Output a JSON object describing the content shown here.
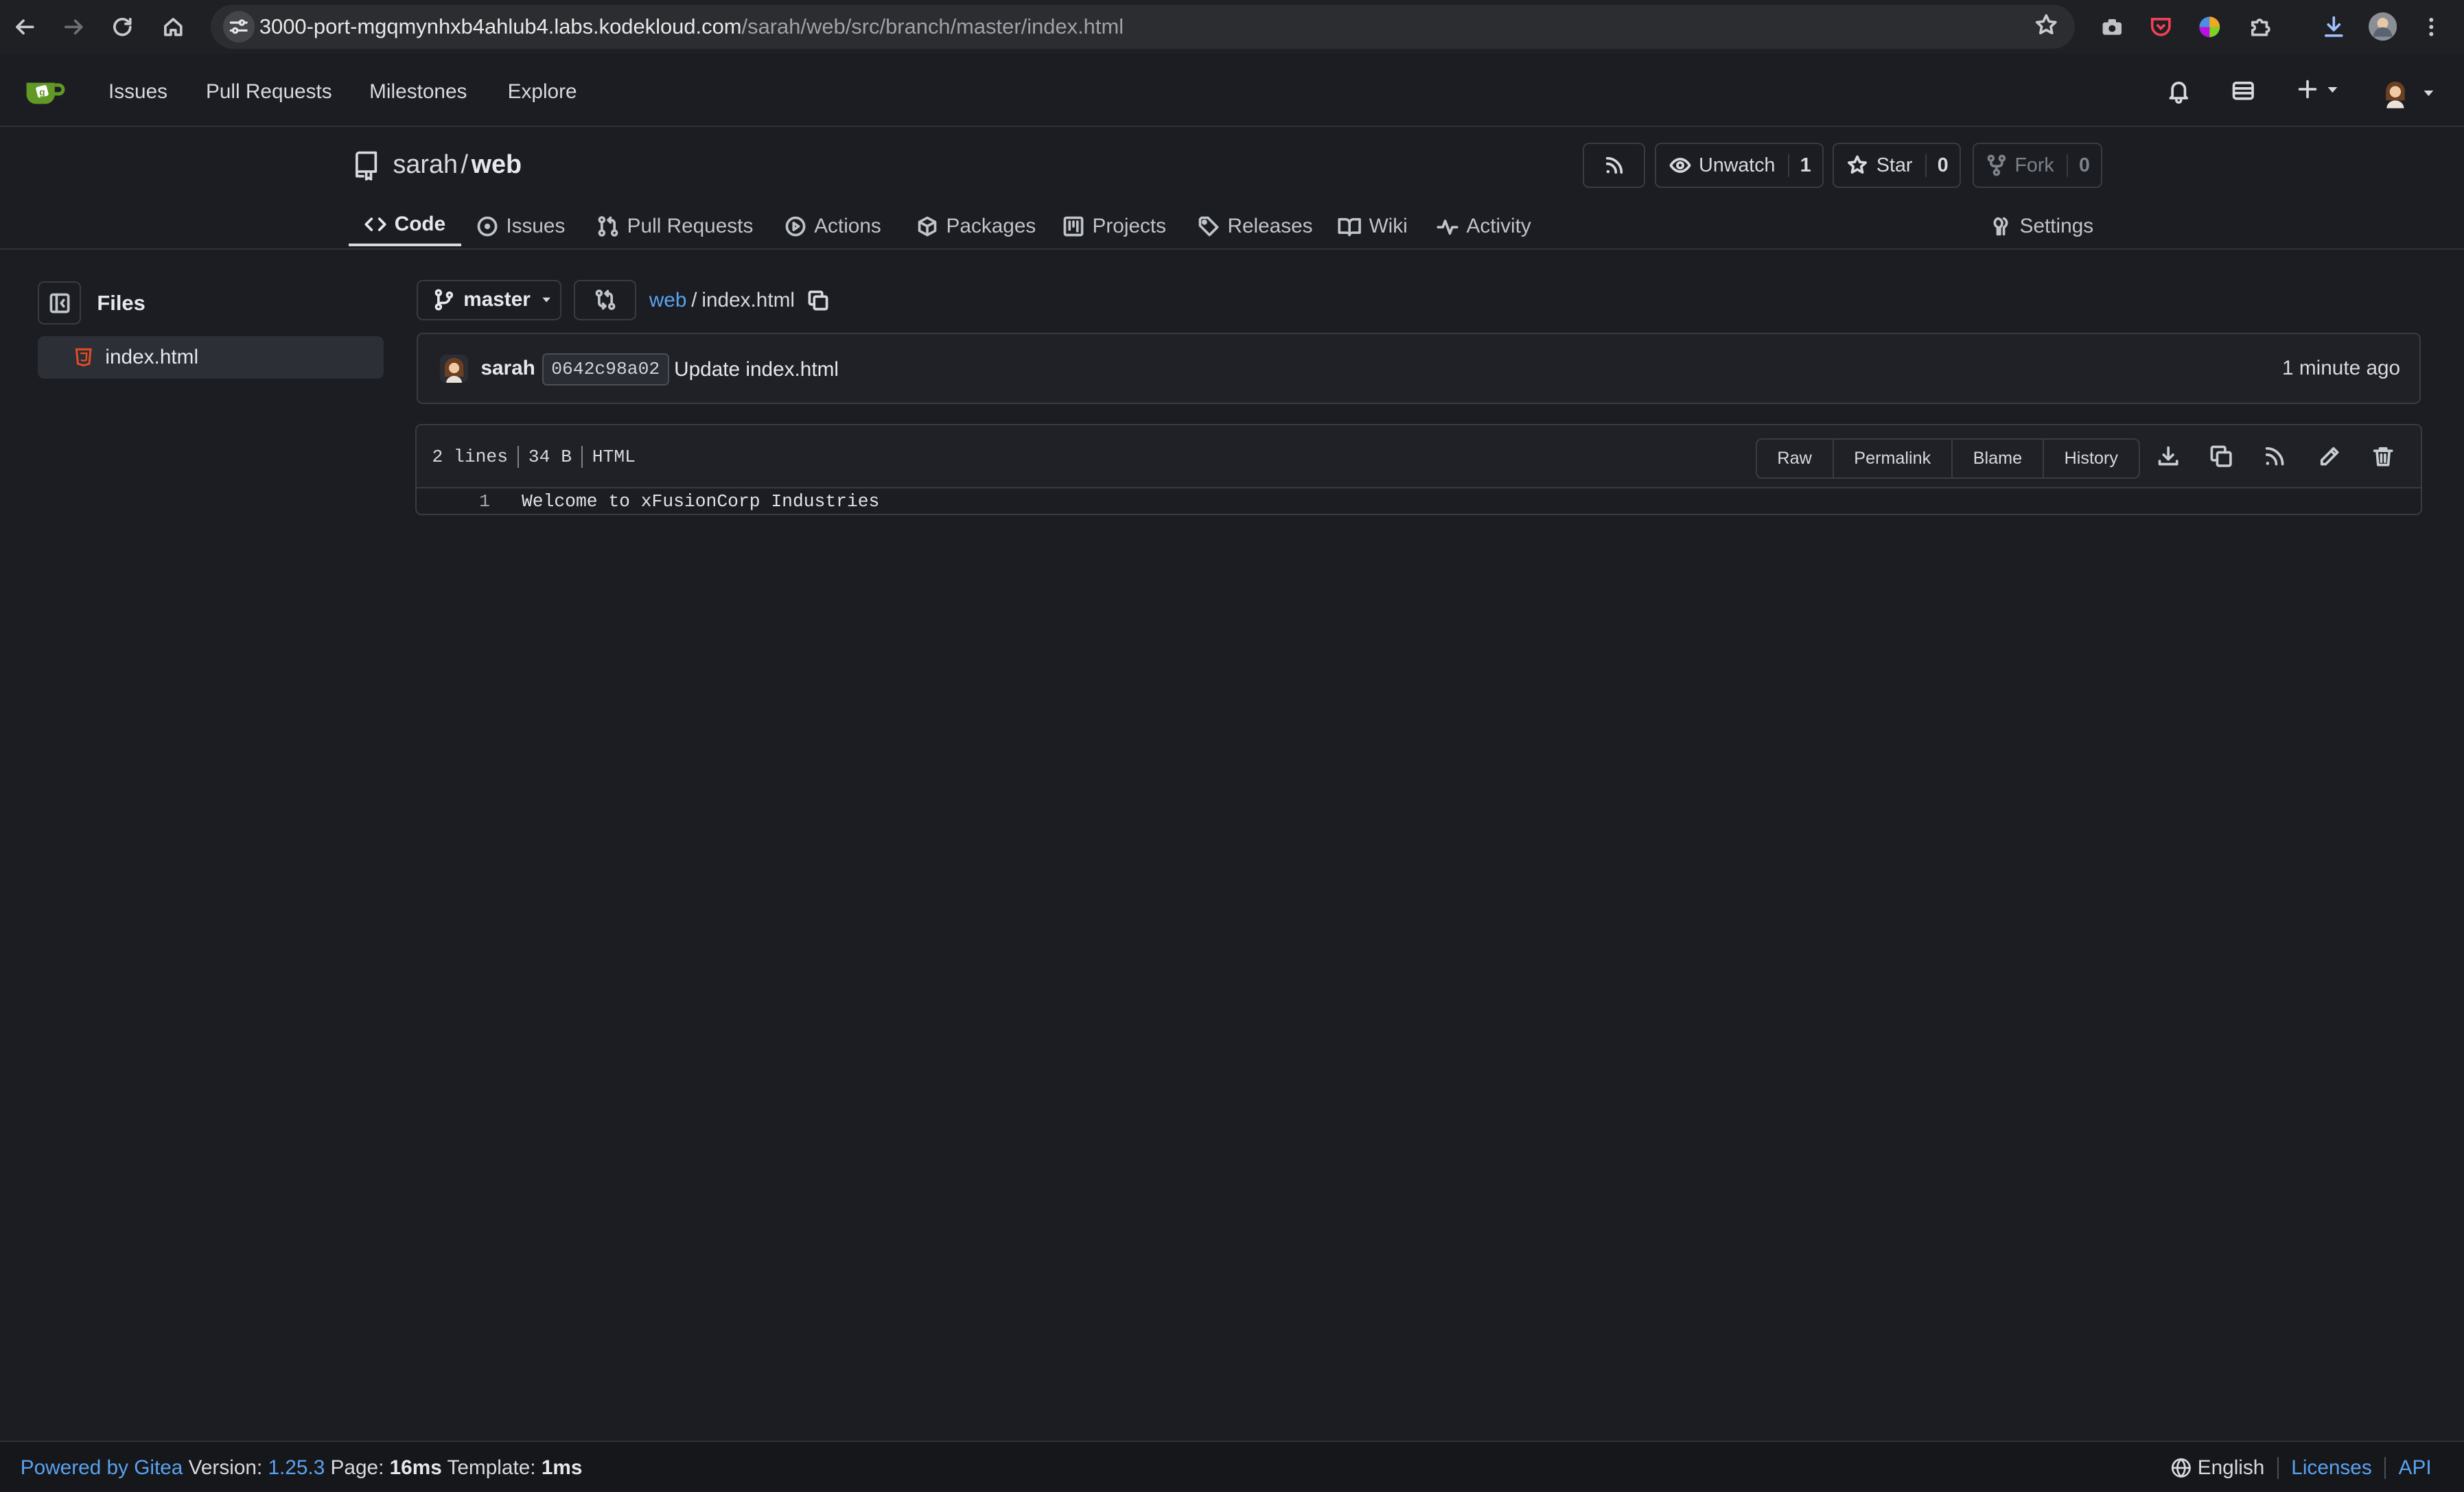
{
  "browser": {
    "url_host": "3000-port-mgqmynhxb4ahlub4.labs.kodekloud.com",
    "url_path": "/sarah/web/src/branch/master/index.html"
  },
  "navbar": {
    "items": [
      "Issues",
      "Pull Requests",
      "Milestones",
      "Explore"
    ]
  },
  "repo": {
    "owner": "sarah",
    "separator": "/",
    "name": "web",
    "unwatch_label": "Unwatch",
    "watch_count": "1",
    "star_label": "Star",
    "star_count": "0",
    "fork_label": "Fork",
    "fork_count": "0"
  },
  "tabs": {
    "code": "Code",
    "issues": "Issues",
    "pulls": "Pull Requests",
    "actions": "Actions",
    "packages": "Packages",
    "projects": "Projects",
    "releases": "Releases",
    "wiki": "Wiki",
    "activity": "Activity",
    "settings": "Settings"
  },
  "sidebar": {
    "title": "Files",
    "files": [
      "index.html"
    ]
  },
  "branch": {
    "name": "master"
  },
  "breadcrumb": {
    "repo": "web",
    "sep": "/",
    "file": "index.html"
  },
  "commit": {
    "author": "sarah",
    "sha": "0642c98a02",
    "message": "Update index.html",
    "time": "1 minute ago"
  },
  "file": {
    "lines_info": "2 lines",
    "size_info": "34 B",
    "lang_info": "HTML",
    "buttons": [
      "Raw",
      "Permalink",
      "Blame",
      "History"
    ],
    "code": [
      {
        "num": "1",
        "text": "Welcome to xFusionCorp Industries"
      }
    ]
  },
  "footer": {
    "powered": "Powered by Gitea",
    "version_label": "Version:",
    "version": "1.25.3",
    "page_label": "Page:",
    "page_time": "16ms",
    "template_label": "Template:",
    "template_time": "1ms",
    "language": "English",
    "licenses": "Licenses",
    "api": "API"
  },
  "colors": {
    "background": "#1b1d22",
    "link": "#5aa2f0",
    "gitea_green": "#609926",
    "html_icon": "#e34c26"
  }
}
